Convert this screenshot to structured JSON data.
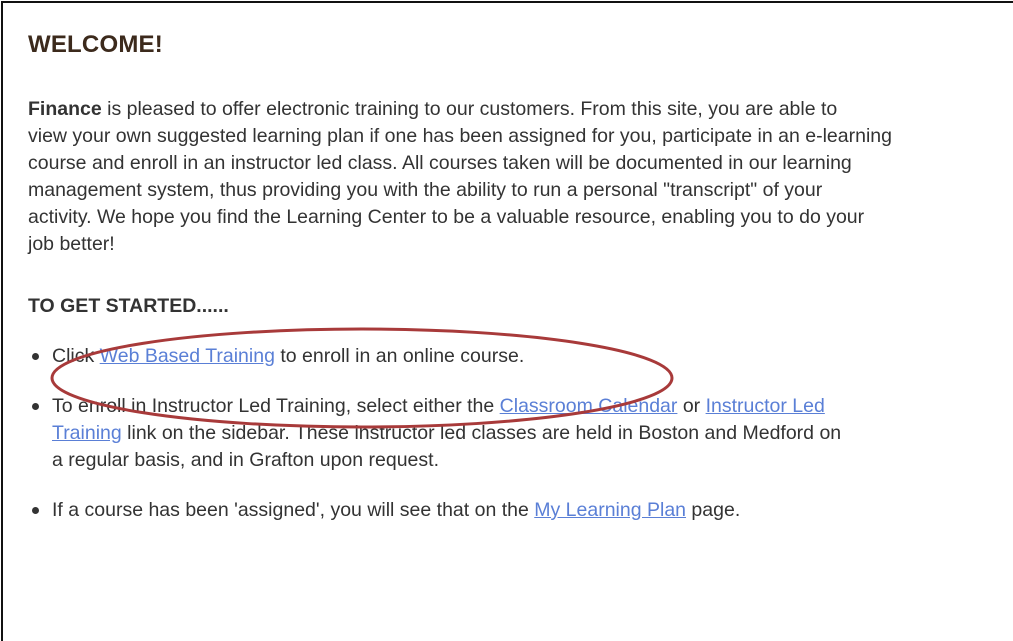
{
  "welcome": {
    "title": "WELCOME!",
    "intro_brand": "Finance",
    "intro_lines": [
      " is pleased to offer electronic training to our customers.  From this site, you are able to",
      "view your own suggested learning plan if one has been assigned for you, participate in an e-learning",
      "course and enroll in an instructor led class.  All courses taken will be documented in our learning",
      "management system, thus providing you with the ability to run a personal \"transcript\" of your",
      "activity.  We hope you find the Learning Center to be a valuable resource, enabling you to do your",
      "job better!"
    ]
  },
  "get_started": {
    "heading": "TO GET STARTED......",
    "steps": [
      {
        "pre": "Click ",
        "link": "Web Based Training",
        "post": " to enroll in an online course."
      },
      {
        "pre": "To enroll in Instructor Led Training, select either the ",
        "link1": "Classroom Calendar",
        "mid": " or ",
        "link2a": "Instructor Led",
        "link2b": "Training",
        "post1": " link on the sidebar.  These instructor led classes are held in Boston and Medford on",
        "post2": "a regular basis, and in Grafton upon request."
      },
      {
        "pre": "If a course has been 'assigned', you will see that on the ",
        "link": "My Learning Plan",
        "post": " page."
      }
    ]
  },
  "colors": {
    "title": "#3c2a1c",
    "text": "#333333",
    "link": "#5a7fd6",
    "highlight_ellipse": "#a83a3a"
  }
}
